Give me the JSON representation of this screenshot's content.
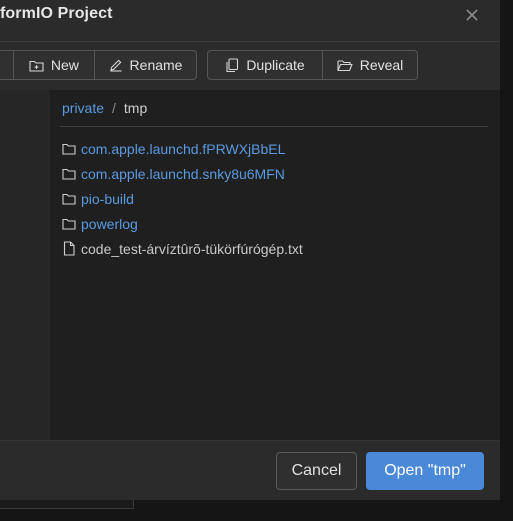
{
  "dialog": {
    "title": "formIO Project"
  },
  "toolbar": {
    "new_label": "New",
    "rename_label": "Rename",
    "duplicate_label": "Duplicate",
    "reveal_label": "Reveal"
  },
  "breadcrumb": {
    "parent": "private",
    "separator": "/",
    "current": "tmp"
  },
  "files": [
    {
      "name": "com.apple.launchd.fPRWXjBbEL",
      "type": "folder",
      "icon": "folder-icon"
    },
    {
      "name": "com.apple.launchd.snky8u6MFN",
      "type": "folder",
      "icon": "folder-icon"
    },
    {
      "name": "pio-build",
      "type": "folder",
      "icon": "folder-icon"
    },
    {
      "name": "powerlog",
      "type": "folder",
      "icon": "folder-icon"
    },
    {
      "name": "code_test-árvíztûrõ-tükörfúrógép.txt",
      "type": "file",
      "icon": "file-icon"
    }
  ],
  "footer": {
    "cancel_label": "Cancel",
    "open_label": "Open \"tmp\""
  },
  "colors": {
    "link": "#5a9ae0",
    "primary": "#4a89d8",
    "dialog_bg": "#2b2b2b",
    "panel_bg": "#1f1f1f"
  }
}
